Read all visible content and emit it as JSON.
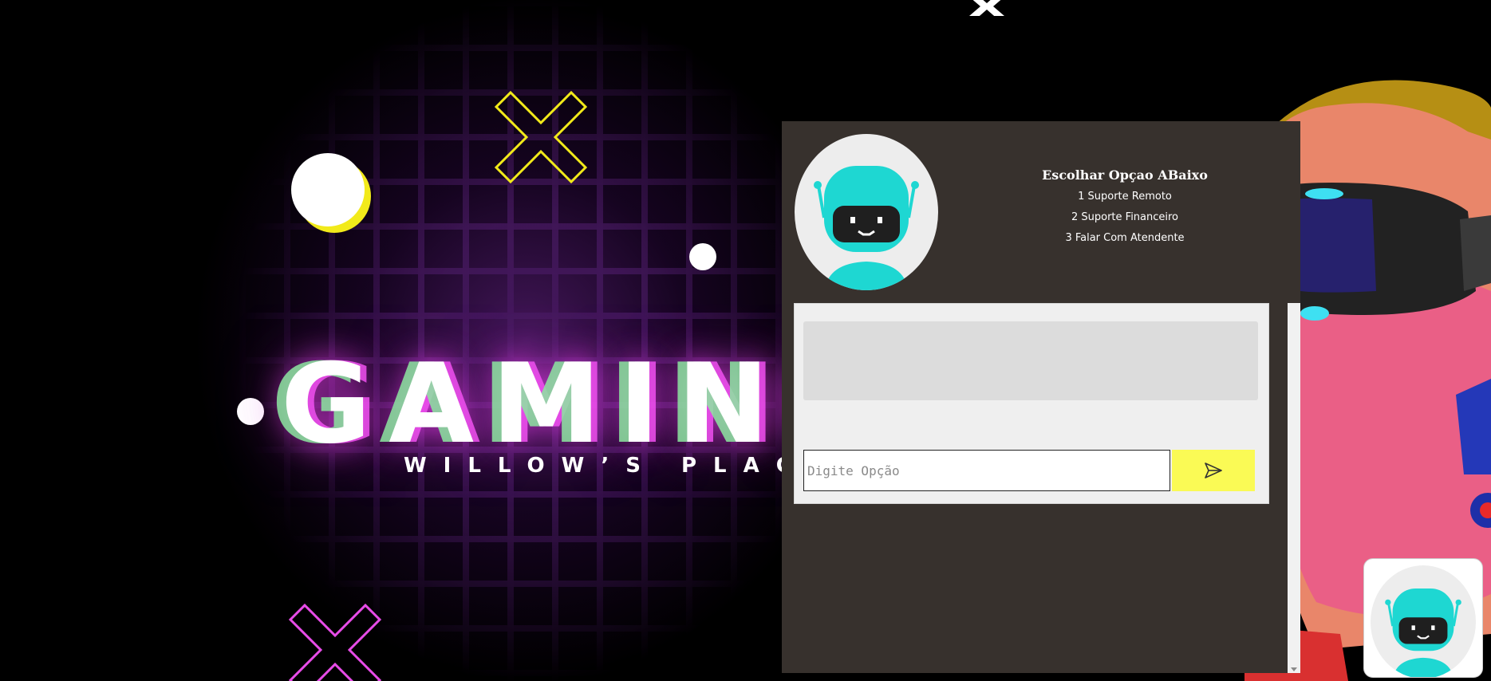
{
  "background": {
    "headline": "GAMING",
    "subheadline": "WILLOW’S PLACE",
    "colors": {
      "yellow": "#f2ea1a",
      "magenta": "#e84ce8",
      "mint": "#8ce6a0",
      "grid": "#461f5f"
    }
  },
  "chat": {
    "bot_icon": "robot-icon",
    "title": "Escolhar Opçao ABaixo",
    "options": [
      "1 Suporte Remoto",
      "2 Suporte Financeiro",
      "3 Falar Com Atendente"
    ],
    "input": {
      "placeholder": "Digite Opção",
      "value": ""
    },
    "send_icon": "send-icon",
    "colors": {
      "panel": "#37312d",
      "send": "#fafa55",
      "bot": "#1ed7d2"
    }
  },
  "launcher": {
    "icon": "robot-icon"
  }
}
